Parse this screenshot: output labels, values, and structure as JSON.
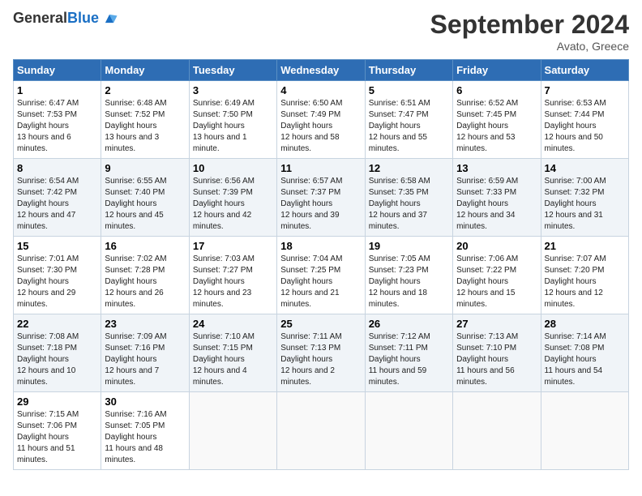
{
  "header": {
    "logo_line1": "General",
    "logo_line2": "Blue",
    "month_title": "September 2024",
    "subtitle": "Avato, Greece"
  },
  "days_of_week": [
    "Sunday",
    "Monday",
    "Tuesday",
    "Wednesday",
    "Thursday",
    "Friday",
    "Saturday"
  ],
  "weeks": [
    [
      {
        "num": "1",
        "sunrise": "6:47 AM",
        "sunset": "7:53 PM",
        "daylight": "13 hours and 6 minutes."
      },
      {
        "num": "2",
        "sunrise": "6:48 AM",
        "sunset": "7:52 PM",
        "daylight": "13 hours and 3 minutes."
      },
      {
        "num": "3",
        "sunrise": "6:49 AM",
        "sunset": "7:50 PM",
        "daylight": "13 hours and 1 minute."
      },
      {
        "num": "4",
        "sunrise": "6:50 AM",
        "sunset": "7:49 PM",
        "daylight": "12 hours and 58 minutes."
      },
      {
        "num": "5",
        "sunrise": "6:51 AM",
        "sunset": "7:47 PM",
        "daylight": "12 hours and 55 minutes."
      },
      {
        "num": "6",
        "sunrise": "6:52 AM",
        "sunset": "7:45 PM",
        "daylight": "12 hours and 53 minutes."
      },
      {
        "num": "7",
        "sunrise": "6:53 AM",
        "sunset": "7:44 PM",
        "daylight": "12 hours and 50 minutes."
      }
    ],
    [
      {
        "num": "8",
        "sunrise": "6:54 AM",
        "sunset": "7:42 PM",
        "daylight": "12 hours and 47 minutes."
      },
      {
        "num": "9",
        "sunrise": "6:55 AM",
        "sunset": "7:40 PM",
        "daylight": "12 hours and 45 minutes."
      },
      {
        "num": "10",
        "sunrise": "6:56 AM",
        "sunset": "7:39 PM",
        "daylight": "12 hours and 42 minutes."
      },
      {
        "num": "11",
        "sunrise": "6:57 AM",
        "sunset": "7:37 PM",
        "daylight": "12 hours and 39 minutes."
      },
      {
        "num": "12",
        "sunrise": "6:58 AM",
        "sunset": "7:35 PM",
        "daylight": "12 hours and 37 minutes."
      },
      {
        "num": "13",
        "sunrise": "6:59 AM",
        "sunset": "7:33 PM",
        "daylight": "12 hours and 34 minutes."
      },
      {
        "num": "14",
        "sunrise": "7:00 AM",
        "sunset": "7:32 PM",
        "daylight": "12 hours and 31 minutes."
      }
    ],
    [
      {
        "num": "15",
        "sunrise": "7:01 AM",
        "sunset": "7:30 PM",
        "daylight": "12 hours and 29 minutes."
      },
      {
        "num": "16",
        "sunrise": "7:02 AM",
        "sunset": "7:28 PM",
        "daylight": "12 hours and 26 minutes."
      },
      {
        "num": "17",
        "sunrise": "7:03 AM",
        "sunset": "7:27 PM",
        "daylight": "12 hours and 23 minutes."
      },
      {
        "num": "18",
        "sunrise": "7:04 AM",
        "sunset": "7:25 PM",
        "daylight": "12 hours and 21 minutes."
      },
      {
        "num": "19",
        "sunrise": "7:05 AM",
        "sunset": "7:23 PM",
        "daylight": "12 hours and 18 minutes."
      },
      {
        "num": "20",
        "sunrise": "7:06 AM",
        "sunset": "7:22 PM",
        "daylight": "12 hours and 15 minutes."
      },
      {
        "num": "21",
        "sunrise": "7:07 AM",
        "sunset": "7:20 PM",
        "daylight": "12 hours and 12 minutes."
      }
    ],
    [
      {
        "num": "22",
        "sunrise": "7:08 AM",
        "sunset": "7:18 PM",
        "daylight": "12 hours and 10 minutes."
      },
      {
        "num": "23",
        "sunrise": "7:09 AM",
        "sunset": "7:16 PM",
        "daylight": "12 hours and 7 minutes."
      },
      {
        "num": "24",
        "sunrise": "7:10 AM",
        "sunset": "7:15 PM",
        "daylight": "12 hours and 4 minutes."
      },
      {
        "num": "25",
        "sunrise": "7:11 AM",
        "sunset": "7:13 PM",
        "daylight": "12 hours and 2 minutes."
      },
      {
        "num": "26",
        "sunrise": "7:12 AM",
        "sunset": "7:11 PM",
        "daylight": "11 hours and 59 minutes."
      },
      {
        "num": "27",
        "sunrise": "7:13 AM",
        "sunset": "7:10 PM",
        "daylight": "11 hours and 56 minutes."
      },
      {
        "num": "28",
        "sunrise": "7:14 AM",
        "sunset": "7:08 PM",
        "daylight": "11 hours and 54 minutes."
      }
    ],
    [
      {
        "num": "29",
        "sunrise": "7:15 AM",
        "sunset": "7:06 PM",
        "daylight": "11 hours and 51 minutes."
      },
      {
        "num": "30",
        "sunrise": "7:16 AM",
        "sunset": "7:05 PM",
        "daylight": "11 hours and 48 minutes."
      },
      null,
      null,
      null,
      null,
      null
    ]
  ]
}
